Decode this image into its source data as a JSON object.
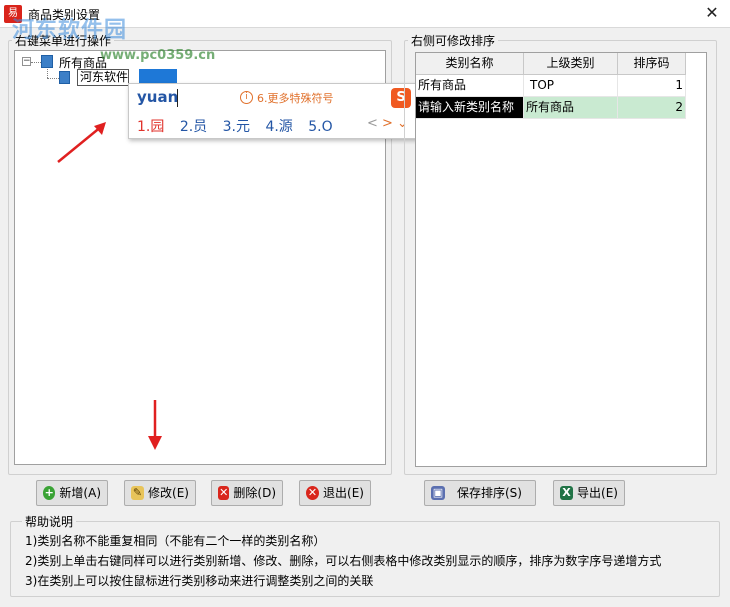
{
  "window": {
    "title": "商品类别设置",
    "close_glyph": "✕",
    "app_icon_label": "易"
  },
  "watermark": {
    "text": "河东软件园",
    "url": "www.pc0359.cn"
  },
  "left_group": {
    "legend": "右键菜单进行操作"
  },
  "tree": {
    "root": {
      "label": "所有商品",
      "expander": "−"
    },
    "editing_value": "河东软件"
  },
  "ime": {
    "pinyin": "yuan",
    "hint": "6.更多特殊符号",
    "logo": "S",
    "candidates": [
      "1.园",
      "2.员",
      "3.元",
      "4.源",
      "5.O"
    ],
    "nav": [
      "<",
      ">",
      "⌄"
    ]
  },
  "right_group": {
    "legend": "右侧可修改排序"
  },
  "table": {
    "columns": [
      "类别名称",
      "上级类别",
      "排序码"
    ],
    "rows": [
      {
        "name": "所有商品",
        "parent": "TOP",
        "order": "1"
      },
      {
        "name": "请输入新类别名称",
        "parent": "所有商品",
        "order": "2"
      }
    ]
  },
  "buttons": {
    "add": "新增(A)",
    "edit": "修改(E)",
    "delete": "删除(D)",
    "exit": "退出(E)",
    "save_order": "保存排序(S)",
    "export": "导出(E)"
  },
  "help": {
    "legend": "帮助说明",
    "lines": [
      "1)类别名称不能重复相同（不能有二个一样的类别名称）",
      "2)类别上单击右键同样可以进行类别新增、修改、删除，可以右侧表格中修改类别显示的顺序，排序为数字序号递增方式",
      "3)在类别上可以按住鼠标进行类别移动来进行调整类别之间的关联"
    ]
  },
  "colors": {
    "accent_blue": "#1e78d7",
    "selected_row": "#c9ead1",
    "arrow_red": "#e02020",
    "ime_text": "#2456a5"
  }
}
